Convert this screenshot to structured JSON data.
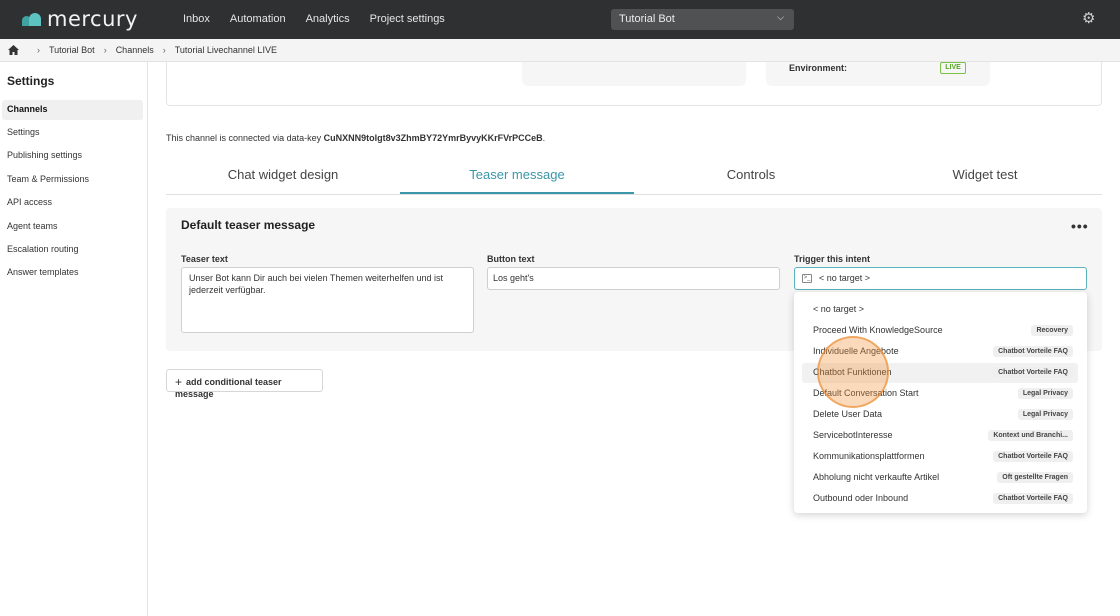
{
  "app": {
    "brand": "mercury"
  },
  "topnav": {
    "inbox": "Inbox",
    "automation": "Automation",
    "analytics": "Analytics",
    "project_settings": "Project settings"
  },
  "bot_select": {
    "value": "Tutorial Bot"
  },
  "breadcrumb": {
    "items": [
      "Tutorial Bot",
      "Channels",
      "Tutorial Livechannel LIVE"
    ]
  },
  "sidebar": {
    "title": "Settings",
    "items": [
      {
        "label": "Channels",
        "active": true
      },
      {
        "label": "Settings"
      },
      {
        "label": "Publishing settings"
      },
      {
        "label": "Team & Permissions"
      },
      {
        "label": "API access"
      },
      {
        "label": "Agent teams"
      },
      {
        "label": "Escalation routing"
      },
      {
        "label": "Answer templates"
      }
    ]
  },
  "channel_info": {
    "environment_label": "Environment:",
    "environment_value": "LIVE"
  },
  "datakey": {
    "prefix": "This channel is connected via data-key",
    "key": "CuNXNN9tolgt8v3ZhmBY72YmrByvyKKrFVrPCCeB",
    "suffix": "."
  },
  "tabs": [
    "Chat widget design",
    "Teaser message",
    "Controls",
    "Widget test"
  ],
  "panel": {
    "title": "Default teaser message",
    "more": "•••",
    "teaser_label": "Teaser text",
    "teaser_value": "Unser Bot kann Dir auch bei vielen Themen weiterhelfen und ist jederzeit  verfügbar.",
    "button_label": "Button text",
    "button_value": "Los geht's",
    "intent_label": "Trigger this intent",
    "intent_value": "< no target >"
  },
  "add_conditional": "add conditional teaser message",
  "dropdown": {
    "items": [
      {
        "label": "< no target >",
        "badge": ""
      },
      {
        "label": "Proceed With KnowledgeSource",
        "badge": "Recovery"
      },
      {
        "label": "Individuelle Angebote",
        "badge": "Chatbot Vorteile FAQ"
      },
      {
        "label": "Chatbot Funktionen",
        "badge": "Chatbot Vorteile FAQ"
      },
      {
        "label": "Default Conversation Start",
        "badge": "Legal Privacy"
      },
      {
        "label": "Delete User Data",
        "badge": "Legal Privacy"
      },
      {
        "label": "ServicebotInteresse",
        "badge": "Kontext und Branchi..."
      },
      {
        "label": "Kommunikationsplattformen",
        "badge": "Chatbot Vorteile FAQ"
      },
      {
        "label": "Abholung nicht verkaufte Artikel",
        "badge": "Oft gestellte Fragen"
      },
      {
        "label": "Outbound oder Inbound",
        "badge": "Chatbot Vorteile FAQ"
      }
    ]
  },
  "colors": {
    "accent": "#3a96a8",
    "topbar": "#2f3032",
    "live": "#58a526"
  }
}
